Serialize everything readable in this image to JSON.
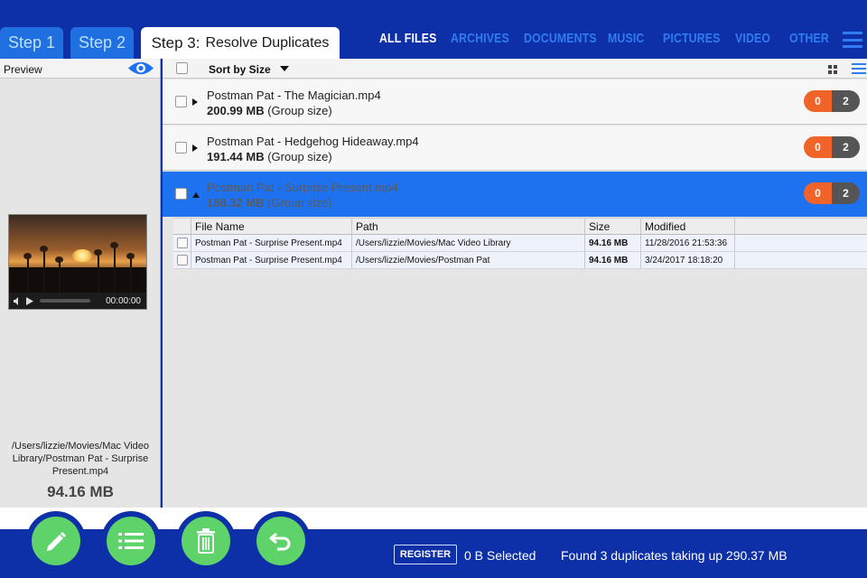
{
  "steps": [
    {
      "label": "Step 1"
    },
    {
      "label": "Step 2"
    },
    {
      "label": "Step 3:",
      "sub": "Resolve Duplicates"
    }
  ],
  "filters": [
    "ALL FILES",
    "ARCHIVES",
    "DOCUMENTS",
    "MUSIC",
    "PICTURES",
    "VIDEO",
    "OTHER"
  ],
  "preview": {
    "label": "Preview",
    "video_time": "00:00:00",
    "path": "/Users/lizzie/Movies/Mac Video Library/Postman Pat - Surprise Present.mp4",
    "size": "94.16 MB"
  },
  "list": {
    "sort_label": "Sort by Size",
    "groups": [
      {
        "name": "Postman Pat - The Magician.mp4",
        "size": "200.99 MB",
        "size_note": "(Group size)",
        "badge_left": "0",
        "badge_right": "2"
      },
      {
        "name": "Postman Pat - Hedgehog Hideaway.mp4",
        "size": "191.44 MB",
        "size_note": "(Group size)",
        "badge_left": "0",
        "badge_right": "2"
      },
      {
        "name": "Postman Pat - Surprise Present.mp4",
        "size": "188.32 MB",
        "size_note": "(Group size)",
        "badge_left": "0",
        "badge_right": "2"
      }
    ],
    "table": {
      "headers": [
        "File Name",
        "Path",
        "Size",
        "Modified"
      ],
      "rows": [
        [
          "Postman Pat - Surprise Present.mp4",
          "/Users/lizzie/Movies/Mac Video Library",
          "94.16 MB",
          "11/28/2016 21:53:36"
        ],
        [
          "Postman Pat - Surprise Present.mp4",
          "/Users/lizzie/Movies/Postman Pat",
          "94.16 MB",
          "3/24/2017 18:18:20"
        ]
      ]
    }
  },
  "footer": {
    "register": "REGISTER",
    "selected": "0 B Selected",
    "found": "Found 3 duplicates taking up 290.37 MB"
  },
  "colors": {
    "brand_blue": "#0d2fa8",
    "accent_blue": "#1e72f0",
    "badge_orange": "#f0642a",
    "action_green": "#5dd36a"
  }
}
